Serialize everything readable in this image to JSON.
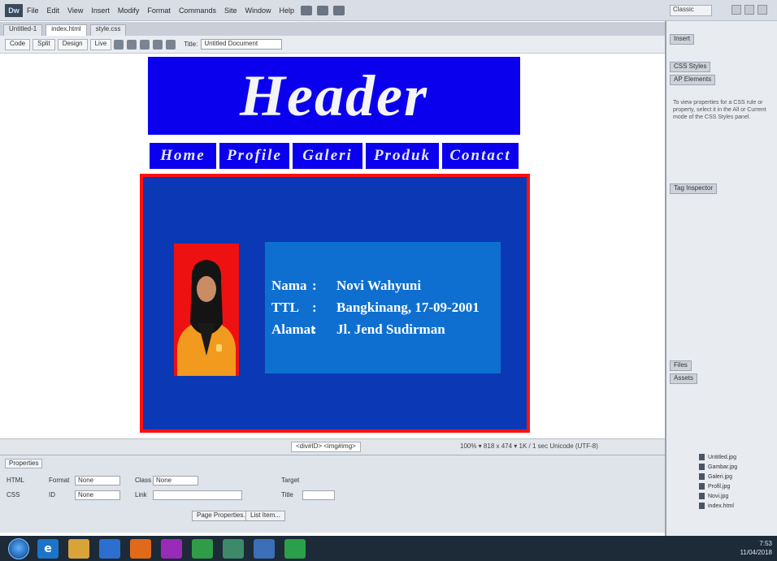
{
  "app": {
    "logo": "Dw",
    "menu": [
      "File",
      "Edit",
      "View",
      "Insert",
      "Modify",
      "Format",
      "Commands",
      "Site",
      "Window",
      "Help"
    ],
    "workspace": "Classic"
  },
  "doc_tabs": [
    "Untitled-1",
    "index.html",
    "style.css"
  ],
  "doc_toolbar": {
    "views": [
      "Code",
      "Split",
      "Design",
      "Live"
    ],
    "title_label": "Title:",
    "title_value": "Untitled Document"
  },
  "site": {
    "header": "Header",
    "nav": [
      "Home",
      "Profile",
      "Galeri",
      "Produk",
      "Contact"
    ],
    "profile": {
      "rows": [
        {
          "label": "Nama",
          "sep": ":",
          "value": "Novi Wahyuni"
        },
        {
          "label": "TTL",
          "sep": ":",
          "value": "Bangkinang, 17-09-2001"
        },
        {
          "label": "Alamat",
          "sep": ":",
          "value": "Jl. Jend Sudirman"
        }
      ]
    }
  },
  "status": {
    "path": "<div#ID> <img#img> ",
    "right": "100% ▾  818 x 474 ▾  1K / 1 sec  Unicode (UTF-8)"
  },
  "properties": {
    "tab": "Properties",
    "labels": [
      "Format",
      "None",
      "Class",
      "None",
      "ID",
      "None",
      "Link",
      "Title",
      "Target",
      "Page Properties...",
      "List Item..."
    ]
  },
  "rightpanel": {
    "sections": [
      "Insert",
      "CSS Styles",
      "AP Elements",
      "Tag Inspector",
      "Files",
      "Assets"
    ],
    "hint": "To view properties for a CSS rule or property, select it in the All or Current mode of the CSS Styles panel.",
    "files": [
      "Untitled.jpg",
      "Gambar.jpg",
      "Galeri.jpg",
      "Profil.jpg",
      "Novi.jpg",
      "index.html"
    ]
  },
  "taskbar": {
    "icons": [
      "ie-icon",
      "folder-icon",
      "media-icon",
      "firefox-icon",
      "opera-icon",
      "chrome-icon",
      "dreamweaver-icon",
      "photoshop-icon",
      "paint-icon"
    ],
    "time": "7:53",
    "date": "11/04/2018"
  },
  "colors": {
    "header_bg": "#0b00ee",
    "panel_bg": "#0b38b4",
    "info_bg": "#0e6fd0",
    "highlight_border": "#ff1010"
  }
}
